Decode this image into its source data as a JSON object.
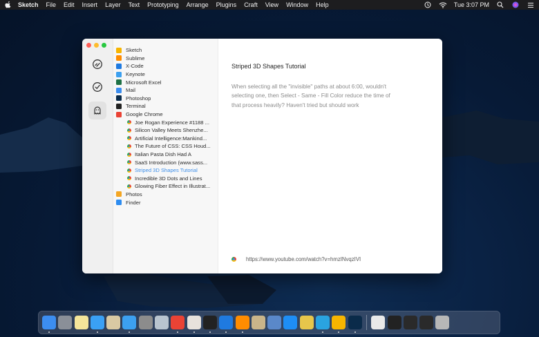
{
  "menubar": {
    "apple_icon": "apple-logo-icon",
    "items": [
      "Sketch",
      "File",
      "Edit",
      "Insert",
      "Layer",
      "Text",
      "Prototyping",
      "Arrange",
      "Plugins",
      "Craft",
      "View",
      "Window",
      "Help"
    ],
    "clock": "Tue 3:07 PM",
    "status_icons": [
      "scroll-lock-icon",
      "wifi-icon",
      "search-icon",
      "siri-icon",
      "list-icon"
    ]
  },
  "sidebar": {
    "buttons": [
      {
        "icon": "clipboard-history-icon",
        "active": false
      },
      {
        "icon": "checkmark-icon",
        "active": false
      },
      {
        "icon": "ghost-icon",
        "active": true
      }
    ]
  },
  "list": {
    "items": [
      {
        "label": "Sketch",
        "type": "app",
        "color": "#f7b500",
        "icon": "sketch-icon"
      },
      {
        "label": "Sublime",
        "type": "app",
        "color": "#ff8c00",
        "icon": "sublime-icon"
      },
      {
        "label": "X-Code",
        "type": "app",
        "color": "#1f7ae0",
        "icon": "xcode-icon"
      },
      {
        "label": "Keynote",
        "type": "app",
        "color": "#3ca0f0",
        "icon": "keynote-icon"
      },
      {
        "label": "Microsoft Excel",
        "type": "app",
        "color": "#1e7145",
        "icon": "excel-icon"
      },
      {
        "label": "Mail",
        "type": "app",
        "color": "#3a8df0",
        "icon": "mail-icon"
      },
      {
        "label": "Photoshop",
        "type": "app",
        "color": "#0a2b4a",
        "icon": "photoshop-icon"
      },
      {
        "label": "Terminal",
        "type": "app",
        "color": "#222222",
        "icon": "terminal-icon"
      },
      {
        "label": "Google Chrome",
        "type": "app",
        "color": "#ea4335",
        "icon": "chrome-icon"
      },
      {
        "label": "Joe Rogan Experience #1188 ...",
        "type": "sub"
      },
      {
        "label": "Silicon Valley Meets Shenzhe...",
        "type": "sub"
      },
      {
        "label": "Artificial Intelligence:Mankind...",
        "type": "sub"
      },
      {
        "label": "The Future of CSS: CSS Houd...",
        "type": "sub"
      },
      {
        "label": "Italian Pasta Dish Had A",
        "type": "sub"
      },
      {
        "label": "SaaS Introduction (www.sass...",
        "type": "sub"
      },
      {
        "label": "Striped 3D Shapes Tutorial",
        "type": "sub",
        "selected": true
      },
      {
        "label": "Incredible 3D Dots and Lines",
        "type": "sub"
      },
      {
        "label": "Glowing Fiber Effect in Illustrat...",
        "type": "sub"
      },
      {
        "label": "Photos",
        "type": "app",
        "color": "#f4a623",
        "icon": "photos-icon"
      },
      {
        "label": "Finder",
        "type": "app",
        "color": "#2d8cf0",
        "icon": "finder-icon"
      }
    ]
  },
  "detail": {
    "title": "Striped 3D Shapes Tutorial",
    "body": "When selecting all the \"invisible\" paths at about 6:00, wouldn't selecting one, then Select - Same - Fill Color reduce the time of that process heavily? Haven't tried but should work",
    "url": "https://www.youtube.com/watch?v=hmzINvqzIVI"
  },
  "dock": {
    "apps": [
      {
        "icon": "finder-icon",
        "color": "#3c8df0",
        "running": true
      },
      {
        "icon": "launchpad-icon",
        "color": "#8a8f98",
        "running": false
      },
      {
        "icon": "notes-icon",
        "color": "#f5e59a",
        "running": false
      },
      {
        "icon": "messages-icon",
        "color": "#3aa0f5",
        "running": true
      },
      {
        "icon": "script-editor-icon",
        "color": "#d9c9a3",
        "running": false
      },
      {
        "icon": "keynote-icon",
        "color": "#3ca0f0",
        "running": true
      },
      {
        "icon": "system-preferences-icon",
        "color": "#8c8c8c",
        "running": false
      },
      {
        "icon": "screenshot-icon",
        "color": "#b9c4cf",
        "running": false
      },
      {
        "icon": "chrome-icon",
        "color": "#ea4335",
        "running": true
      },
      {
        "icon": "slack-icon",
        "color": "#e8e2dc",
        "running": true
      },
      {
        "icon": "terminal-icon",
        "color": "#222222",
        "running": true
      },
      {
        "icon": "xcode-icon",
        "color": "#1f7ae0",
        "running": true
      },
      {
        "icon": "sublime-icon",
        "color": "#ff8c00",
        "running": true
      },
      {
        "icon": "preview-icon",
        "color": "#c9b58a",
        "running": false
      },
      {
        "icon": "image-capture-icon",
        "color": "#5a88c9",
        "running": false
      },
      {
        "icon": "app-store-icon",
        "color": "#1e8ef5",
        "running": false
      },
      {
        "icon": "archive-icon",
        "color": "#e7c64b",
        "running": false
      },
      {
        "icon": "telegram-icon",
        "color": "#2aa3e0",
        "running": true
      },
      {
        "icon": "sketch-icon",
        "color": "#f7b500",
        "running": true
      },
      {
        "icon": "photoshop-icon",
        "color": "#0a2b4a",
        "running": true
      }
    ],
    "docs": [
      {
        "icon": "document-icon",
        "color": "#e9e9e9"
      },
      {
        "icon": "screenshot-thumb-icon",
        "color": "#222222"
      },
      {
        "icon": "screenshot-thumb-icon",
        "color": "#2a2a2a"
      },
      {
        "icon": "screenshot-thumb-icon",
        "color": "#2a2a2a"
      },
      {
        "icon": "trash-icon",
        "color": "#b7b7b7"
      }
    ]
  }
}
